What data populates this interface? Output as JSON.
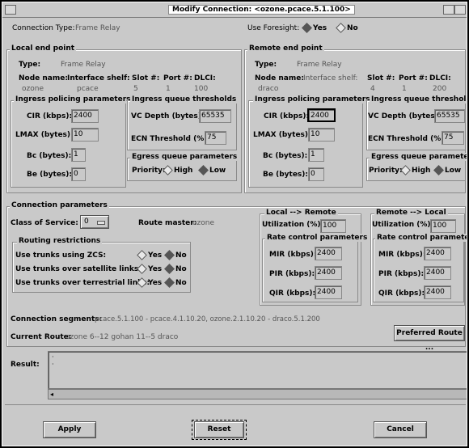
{
  "window": {
    "title": "Modify Connection: <ozone.pcace.5.1.100>"
  },
  "connection_type": {
    "label": "Connection Type:",
    "value": "Frame Relay"
  },
  "use_foresight": {
    "label": "Use Foresight:",
    "yes": "Yes",
    "no": "No",
    "selected": "Yes"
  },
  "local_end": {
    "legend": "Local end point",
    "type_label": "Type:",
    "type_value": "Frame Relay",
    "node_label": "Node name:",
    "iface_label": "Interface shelf:",
    "slot_label": "Slot #:",
    "port_label": "Port #:",
    "dlci_label": "DLCI:",
    "node_value": "ozone",
    "iface_value": "pcace",
    "slot_value": "5",
    "port_value": "1",
    "dlci_value": "100",
    "ingress_policing": {
      "legend": "Ingress policing parameters",
      "cir_label": "CIR (kbps):",
      "cir": "2400",
      "lmax_label": "LMAX (bytes):",
      "lmax": "10",
      "bc_label": "Bc (bytes):",
      "bc": "1",
      "be_label": "Be (bytes):",
      "be": "0"
    },
    "ingress_queue": {
      "legend": "Ingress queue thresholds",
      "vc_label": "VC Depth (bytes):",
      "vc": "65535",
      "ecn_label": "ECN Threshold (%):",
      "ecn": "75"
    },
    "egress_queue": {
      "legend": "Egress queue parameters",
      "priority_label": "Priority:",
      "high": "High",
      "low": "Low",
      "selected": "Low"
    }
  },
  "remote_end": {
    "legend": "Remote end point",
    "type_label": "Type:",
    "type_value": "Frame Relay",
    "node_label": "Node name:",
    "iface_label": "Interface shelf:",
    "slot_label": "Slot #:",
    "port_label": "Port #:",
    "dlci_label": "DLCI:",
    "node_value": "draco",
    "iface_value": "",
    "slot_value": "4",
    "port_value": "1",
    "dlci_value": "200",
    "ingress_policing": {
      "legend": "Ingress policing parameters",
      "cir_label": "CIR (kbps):",
      "cir": "2400",
      "lmax_label": "LMAX (bytes):",
      "lmax": "10",
      "bc_label": "Bc (bytes):",
      "bc": "1",
      "be_label": "Be (bytes):",
      "be": "0"
    },
    "ingress_queue": {
      "legend": "Ingress queue thresholds",
      "vc_label": "VC Depth (bytes):",
      "vc": "65535",
      "ecn_label": "ECN Threshold (%):",
      "ecn": "75"
    },
    "egress_queue": {
      "legend": "Egress queue parameters",
      "priority_label": "Priority:",
      "high": "High",
      "low": "Low",
      "selected": "Low"
    }
  },
  "conn_params": {
    "legend": "Connection parameters",
    "cos_label": "Class of Service:",
    "cos_value": "0",
    "route_master_label": "Route master:",
    "route_master_value": "ozone",
    "routing": {
      "legend": "Routing restrictions",
      "rows": [
        {
          "label": "Use trunks using ZCS:",
          "yes": "Yes",
          "no": "No",
          "selected": "No"
        },
        {
          "label": "Use trunks over satellite links:",
          "yes": "Yes",
          "no": "No",
          "selected": "No"
        },
        {
          "label": "Use trunks over terrestrial links:",
          "yes": "Yes",
          "no": "No",
          "selected": "No"
        }
      ]
    },
    "local_remote": {
      "legend": "Local --> Remote",
      "util_label": "Utilization (%):",
      "util": "100",
      "rate_legend": "Rate control parameters",
      "mir_label": "MIR (kbps):",
      "mir": "2400",
      "pir_label": "PIR (kbps):",
      "pir": "2400",
      "qir_label": "QIR (kbps):",
      "qir": "2400"
    },
    "remote_local": {
      "legend": "Remote --> Local",
      "util_label": "Utilization (%):",
      "util": "100",
      "rate_legend": "Rate control parameters",
      "mir_label": "MIR (kbps):",
      "mir": "2400",
      "pir_label": "PIR (kbps):",
      "pir": "2400",
      "qir_label": "QIR (kbps):",
      "qir": "2400"
    },
    "segments_label": "Connection segments:",
    "segments_value": "pcace.5.1.100 - pcace.4.1.10.20, ozone.2.1.10.20 - draco.5.1.200",
    "route_label": "Current Route:",
    "route_value": "ozone 6--12 gohan 11--5 draco",
    "preferred_route": "Preferred Route ..."
  },
  "result": {
    "label": "Result:"
  },
  "buttons": {
    "apply": "Apply",
    "reset": "Reset",
    "cancel": "Cancel"
  }
}
